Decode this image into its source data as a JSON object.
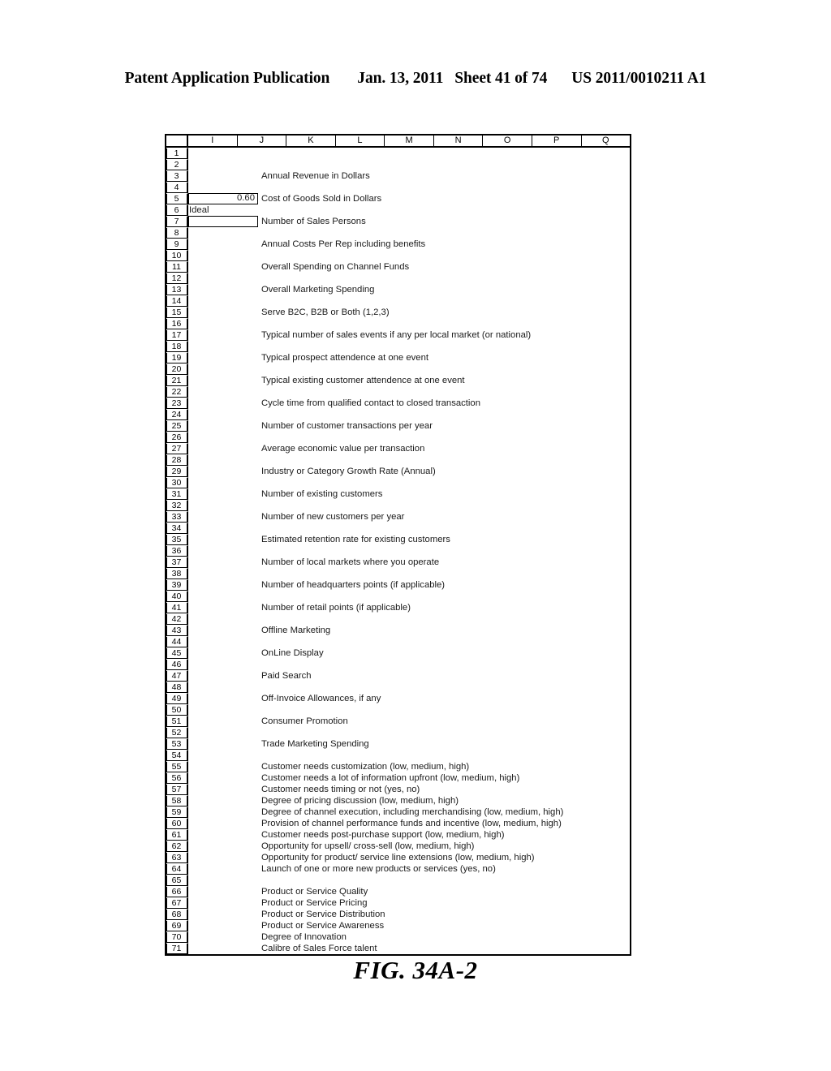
{
  "header": {
    "publication": "Patent Application Publication",
    "date": "Jan. 13, 2011",
    "sheet": "Sheet 41 of 74",
    "patent_number": "US 2011/0010211 A1"
  },
  "figure": {
    "caption": "FIG. 34A-2"
  },
  "spreadsheet": {
    "column_headers": [
      "I",
      "J",
      "K",
      "L",
      "M",
      "N",
      "O",
      "P",
      "Q"
    ],
    "first_row": 1,
    "last_row": 71,
    "cells": {
      "I5": {
        "value": "0.60",
        "boxed": true,
        "align": "right"
      },
      "I6": {
        "value": "Ideal",
        "boxed": false,
        "align": "left"
      },
      "I7": {
        "value": "",
        "boxed": true,
        "align": "right"
      }
    },
    "row_labels": {
      "3": "Annual Revenue in Dollars",
      "5": "Cost of Goods Sold in Dollars",
      "7": "Number of Sales Persons",
      "9": "Annual Costs Per Rep including benefits",
      "11": "Overall Spending on Channel Funds",
      "13": "Overall Marketing Spending",
      "15": "Serve B2C, B2B or Both (1,2,3)",
      "17": "Typical number of sales events if any per local market (or national)",
      "19": "Typical prospect attendence at one event",
      "21": "Typical existing customer attendence at one event",
      "23": "Cycle time from qualified contact to closed transaction",
      "25": "Number of customer transactions per year",
      "27": "Average economic value per transaction",
      "29": "Industry or Category Growth Rate (Annual)",
      "31": "Number of existing customers",
      "33": "Number of new customers per year",
      "35": "Estimated retention rate for existing customers",
      "37": "Number of local markets where you operate",
      "39": "Number of headquarters points (if applicable)",
      "41": "Number of retail points (if applicable)",
      "43": "Offline Marketing",
      "45": "OnLine Display",
      "47": "Paid Search",
      "49": "Off-Invoice Allowances, if any",
      "51": "Consumer Promotion",
      "53": "Trade Marketing Spending",
      "55": "Customer needs customization (low, medium, high)",
      "56": "Customer needs a lot of information upfront (low, medium, high)",
      "57": "Customer needs timing or not (yes, no)",
      "58": "Degree of pricing discussion (low, medium, high)",
      "59": "Degree of channel execution, including merchandising (low, medium, high)",
      "60": "Provision of channel performance funds and incentive (low, medium, high)",
      "61": "Customer needs post-purchase support (low, medium, high)",
      "62": "Opportunity for upsell/ cross-sell (low, medium, high)",
      "63": "Opportunity for product/ service line extensions (low, medium, high)",
      "64": "Launch of one or more new products or services (yes, no)",
      "66": "Product or Service Quality",
      "67": "Product or Service Pricing",
      "68": "Product or Service Distribution",
      "69": "Product or Service Awareness",
      "70": "Degree of Innovation",
      "71": "Calibre of Sales Force talent"
    }
  }
}
